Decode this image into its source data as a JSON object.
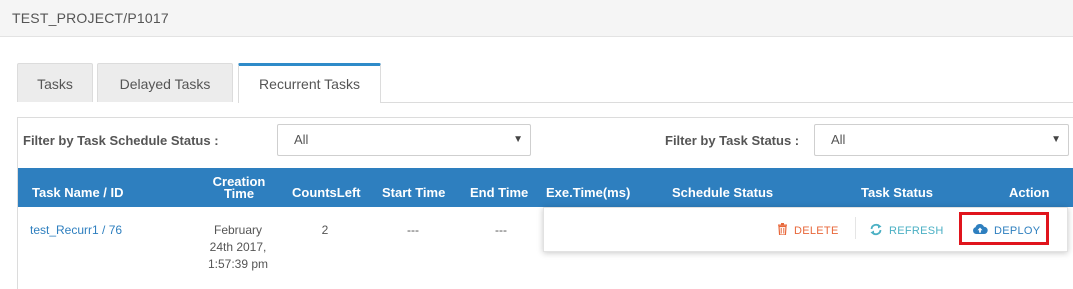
{
  "header": {
    "project_path": "TEST_PROJECT/P1017"
  },
  "tabs": [
    {
      "label": "Tasks"
    },
    {
      "label": "Delayed Tasks"
    },
    {
      "label": "Recurrent Tasks"
    }
  ],
  "filters": {
    "schedule_status_label": "Filter by Task Schedule Status :",
    "schedule_status_value": "All",
    "task_status_label": "Filter by Task Status :",
    "task_status_value": "All"
  },
  "table": {
    "columns": [
      "Task Name / ID",
      "Creation Time",
      "CountsLeft",
      "Start Time",
      "End Time",
      "Exe.Time(ms)",
      "Schedule Status",
      "Task Status",
      "Action"
    ],
    "creation_time_line1": "Creation",
    "creation_time_line2": "Time",
    "rows": [
      {
        "task_name_id": "test_Recurr1 / 76",
        "creation_line1": "February",
        "creation_line2": "24th 2017,",
        "creation_line3": "1:57:39 pm",
        "counts_left": "2",
        "start_time": "---",
        "end_time": "---"
      }
    ]
  },
  "actions": {
    "delete_label": "DELETE",
    "refresh_label": "REFRESH",
    "deploy_label": "DEPLOY"
  },
  "colors": {
    "header_blue": "#2e7fbf",
    "delete": "#e8673a",
    "refresh": "#4bb0c4",
    "deploy": "#2e7fbf",
    "highlight": "#e0141c"
  }
}
